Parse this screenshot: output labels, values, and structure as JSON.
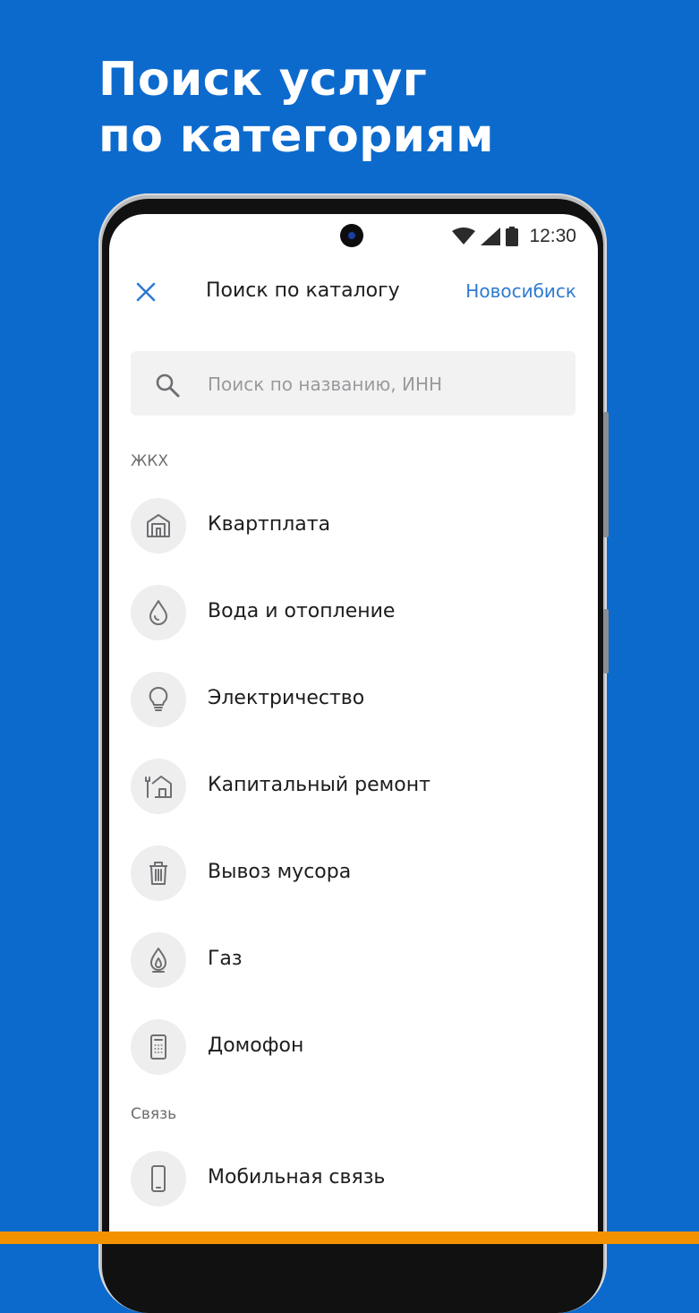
{
  "promo": {
    "line1": "Поиск услуг",
    "line2": "по категориям"
  },
  "status_bar": {
    "time": "12:30",
    "icons": [
      "wifi-icon",
      "signal-icon",
      "battery-icon"
    ]
  },
  "header": {
    "close_icon": "close-icon",
    "title": "Поиск по каталогу",
    "city": "Новосибиск"
  },
  "search": {
    "icon": "search-icon",
    "placeholder": "Поиск по названию, ИНН",
    "value": ""
  },
  "sections": [
    {
      "title": "ЖКХ",
      "items": [
        {
          "label": "Квартплата",
          "icon": "building-icon"
        },
        {
          "label": "Вода и отопление",
          "icon": "water-drop-icon"
        },
        {
          "label": "Электричество",
          "icon": "light-bulb-icon"
        },
        {
          "label": "Капитальный ремонт",
          "icon": "house-repair-icon"
        },
        {
          "label": "Вывоз мусора",
          "icon": "trash-icon"
        },
        {
          "label": "Газ",
          "icon": "gas-flame-icon"
        },
        {
          "label": "Домофон",
          "icon": "intercom-icon"
        }
      ]
    },
    {
      "title": "Связь",
      "items": [
        {
          "label": "Мобильная связь",
          "icon": "mobile-phone-icon"
        }
      ]
    }
  ],
  "colors": {
    "background": "#0c6acd",
    "accent_link": "#2f7ad0",
    "icon_circle": "#eeeeef",
    "bottom_stripe": "#f39200"
  }
}
